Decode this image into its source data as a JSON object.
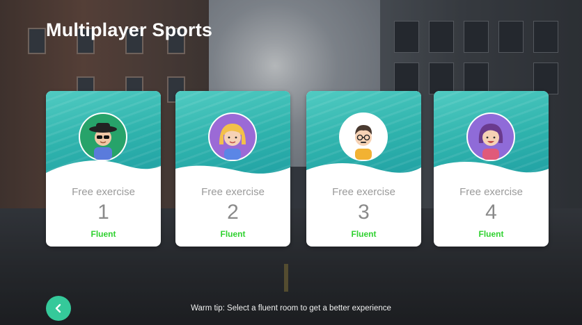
{
  "page": {
    "title": "Multiplayer Sports"
  },
  "rooms": [
    {
      "label": "Free exercise",
      "number": "1",
      "status": "Fluent",
      "avatar": "man-sunglasses-avatar-icon",
      "avatar_bg": "#27a36a"
    },
    {
      "label": "Free exercise",
      "number": "2",
      "status": "Fluent",
      "avatar": "woman-blonde-avatar-icon",
      "avatar_bg": "#9b6ad6"
    },
    {
      "label": "Free exercise",
      "number": "3",
      "status": "Fluent",
      "avatar": "boy-glasses-avatar-icon",
      "avatar_bg": "#ffffff"
    },
    {
      "label": "Free exercise",
      "number": "4",
      "status": "Fluent",
      "avatar": "girl-purple-hair-avatar-icon",
      "avatar_bg": "#8f6bd8"
    }
  ],
  "footer": {
    "back_icon": "chevron-left-icon",
    "tip": "Warm tip: Select a fluent room to get a better experience"
  },
  "colors": {
    "accent": "#35c99a",
    "status": "#2fd12f",
    "water": "#2fb3ad"
  }
}
